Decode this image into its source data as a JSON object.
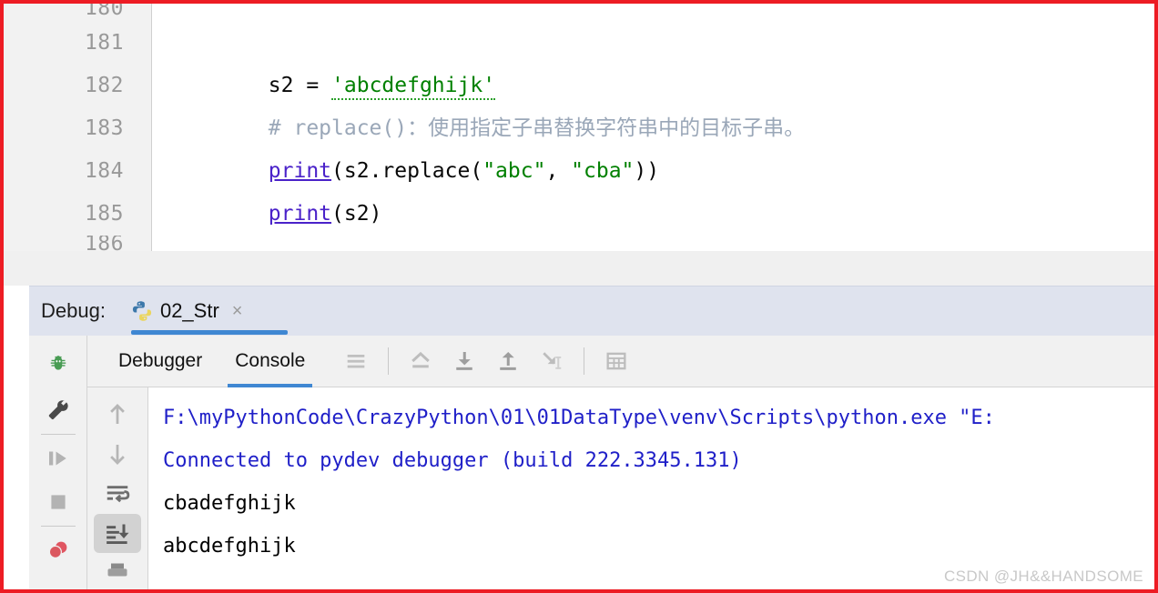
{
  "editor": {
    "lines": [
      {
        "no": "180",
        "partial_top": true,
        "segments": []
      },
      {
        "no": "181",
        "segments": [
          {
            "t": "s2 = ",
            "c": "plain"
          },
          {
            "t": "'abcdefghijk'",
            "c": "str",
            "typo": true
          }
        ]
      },
      {
        "no": "182",
        "segments": [
          {
            "t": "# replace()：使用指定子串替换字符串中的目标子串。",
            "c": "cmt"
          }
        ]
      },
      {
        "no": "183",
        "segments": [
          {
            "t": "print",
            "c": "kw"
          },
          {
            "t": "(s2.replace(",
            "c": "plain"
          },
          {
            "t": "\"abc\"",
            "c": "str"
          },
          {
            "t": ", ",
            "c": "plain"
          },
          {
            "t": "\"cba\"",
            "c": "str"
          },
          {
            "t": "))",
            "c": "plain"
          }
        ]
      },
      {
        "no": "184",
        "segments": [
          {
            "t": "print",
            "c": "kw"
          },
          {
            "t": "(s2)",
            "c": "plain"
          }
        ]
      },
      {
        "no": "185",
        "segments": []
      },
      {
        "no": "186",
        "partial_bottom": true,
        "segments": []
      }
    ],
    "line_numbers": [
      "180",
      "181",
      "182",
      "183",
      "184",
      "185",
      "186"
    ],
    "code_text": [
      "",
      "s2 = 'abcdefghijk'",
      "# replace()：使用指定子串替换字符串中的目标子串。",
      "print(s2.replace(\"abc\", \"cba\"))",
      "print(s2)",
      "",
      ""
    ]
  },
  "debug_header": {
    "label": "Debug:",
    "run_config_name": "02_Str",
    "close_label": "×",
    "icon": "python-icon",
    "active_underline_color": "#3f87d2"
  },
  "left_rail": {
    "items": [
      {
        "name": "debug-icon",
        "title": "Debug"
      },
      {
        "name": "settings-wrench-icon",
        "title": "Settings"
      },
      {
        "name": "resume-program-icon",
        "title": "Resume Program"
      },
      {
        "name": "stop-icon",
        "title": "Stop"
      },
      {
        "name": "view-breakpoints-icon",
        "title": "View Breakpoints"
      }
    ]
  },
  "tabs": [
    {
      "label": "Debugger",
      "active": false
    },
    {
      "label": "Console",
      "active": true
    }
  ],
  "toolbar": {
    "buttons": [
      {
        "name": "show-options-menu-icon",
        "title": "Layout / options"
      },
      {
        "name": "step-over-icon",
        "title": "Step Over"
      },
      {
        "name": "step-into-icon",
        "title": "Step Into"
      },
      {
        "name": "step-out-icon",
        "title": "Step Out"
      },
      {
        "name": "run-to-cursor-icon",
        "title": "Run to Cursor"
      },
      {
        "name": "evaluate-expression-icon",
        "title": "Evaluate Expression"
      }
    ]
  },
  "console_rail": {
    "buttons": [
      {
        "name": "up-arrow-icon",
        "title": "Previous occurrence",
        "selected": false
      },
      {
        "name": "down-arrow-icon",
        "title": "Next occurrence",
        "selected": false
      },
      {
        "name": "soft-wrap-icon",
        "title": "Use Soft Wraps",
        "selected": false
      },
      {
        "name": "scroll-to-end-icon",
        "title": "Scroll to the end",
        "selected": true
      },
      {
        "name": "print-icon",
        "title": "Print",
        "selected": false
      }
    ]
  },
  "console": {
    "lines": [
      {
        "text": "F:\\myPythonCode\\CrazyPython\\01\\01DataType\\venv\\Scripts\\python.exe \"E:",
        "kind": "cmd"
      },
      {
        "text": "Connected to pydev debugger (build 222.3345.131)",
        "kind": "cmd"
      },
      {
        "text": "cbadefghijk",
        "kind": "out"
      },
      {
        "text": "abcdefghijk",
        "kind": "out"
      }
    ]
  },
  "watermark": {
    "text": "CSDN @JH&&HANDSOME"
  },
  "colors": {
    "frame_red": "#ed1c24",
    "accent_blue": "#3f87d2",
    "string_green": "#008000",
    "keyword_purple": "#4a22c9",
    "comment_gray": "#9aa7b8",
    "console_blue": "#1f1fc8",
    "panel_gray": "#f1f1f1",
    "tab_header_blue": "#dfe3ee"
  }
}
